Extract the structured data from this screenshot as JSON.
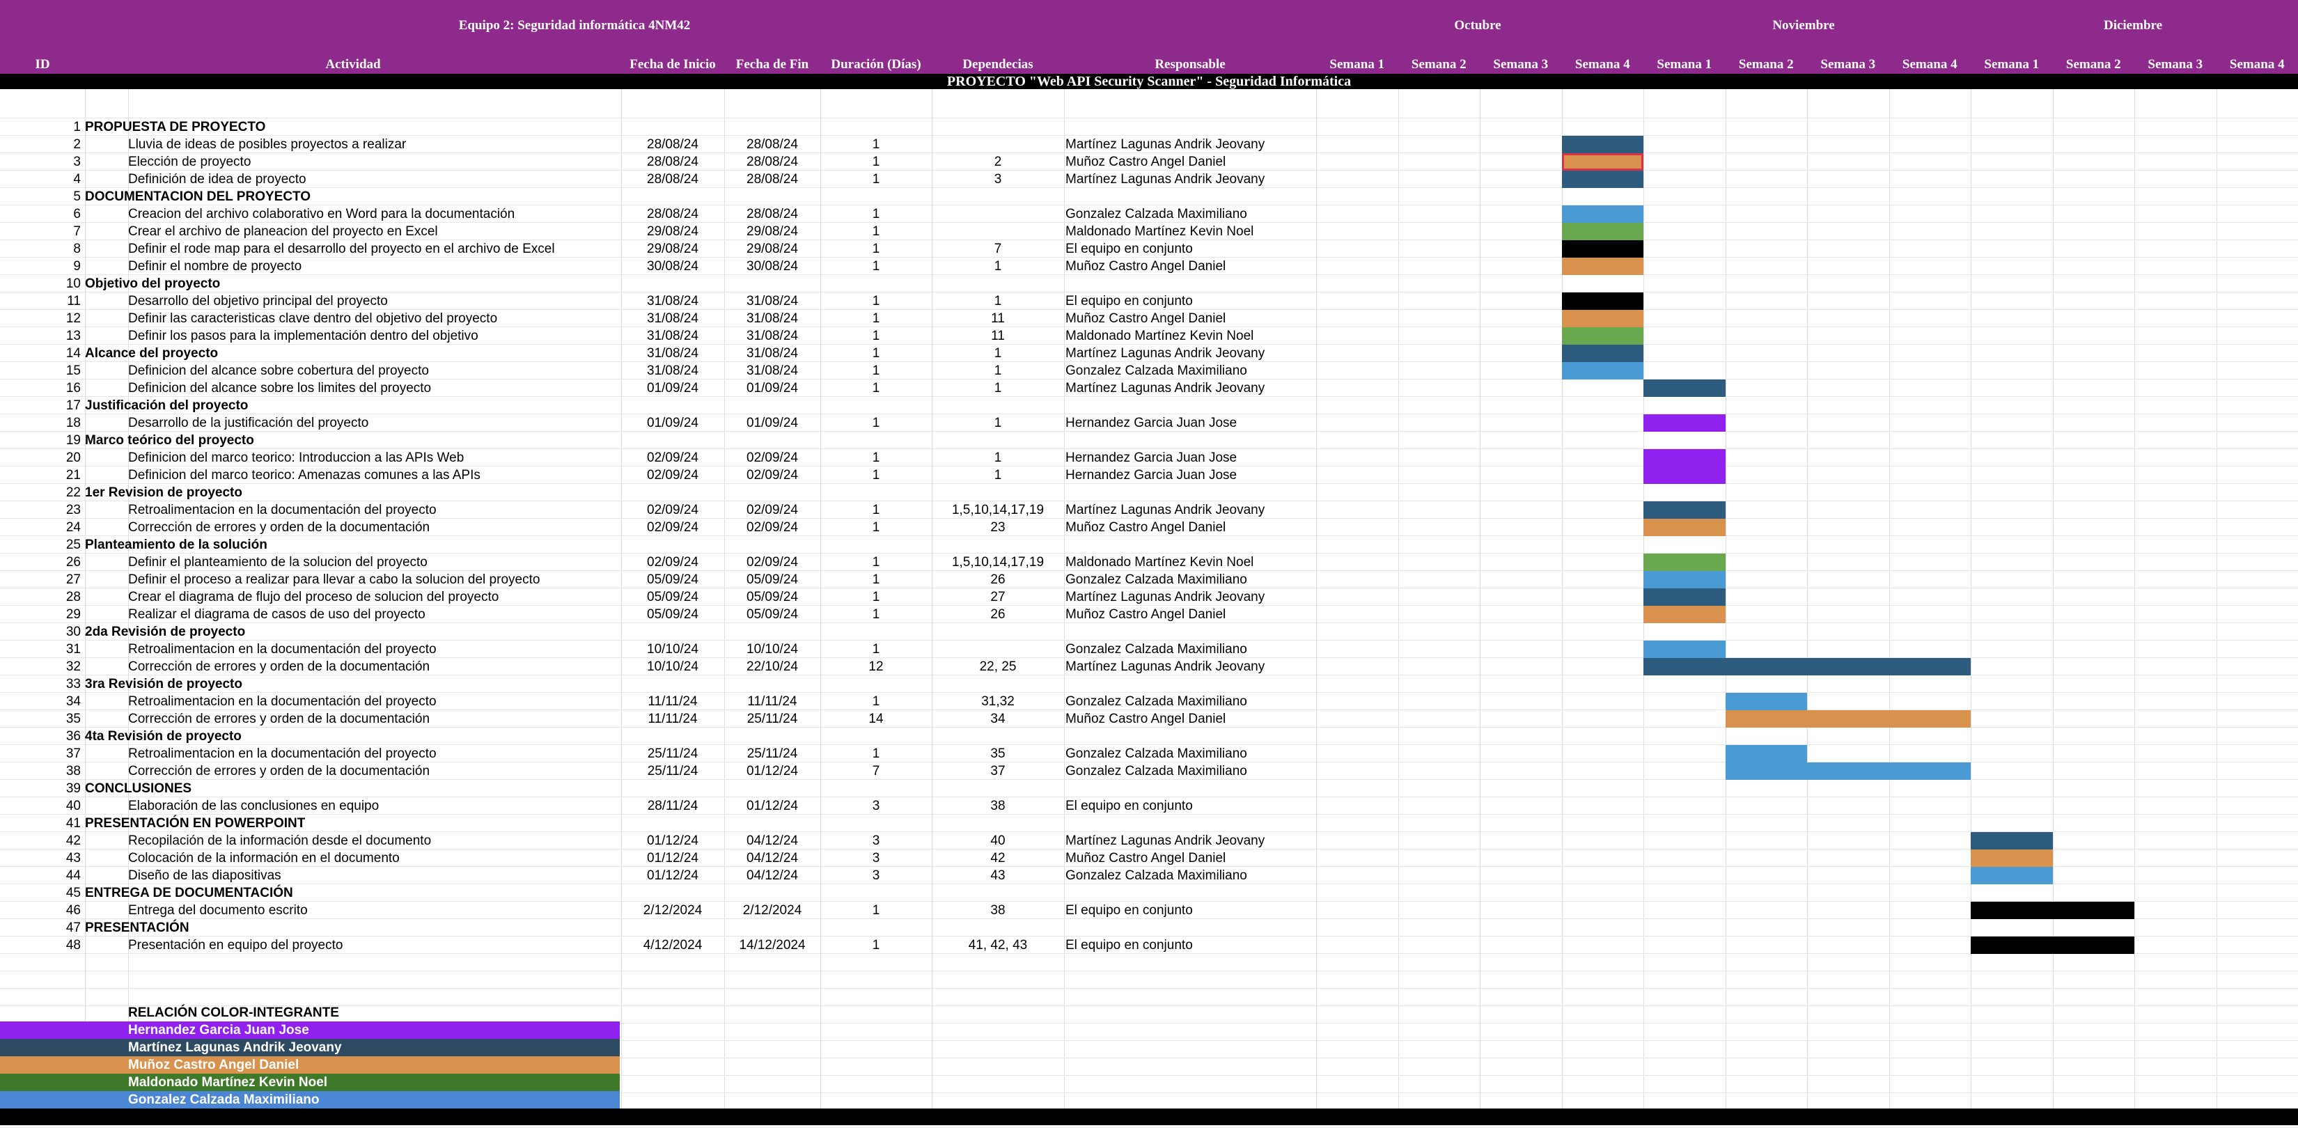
{
  "header": {
    "title": "Equipo 2: Seguridad informática 4NM42",
    "months": [
      "Octubre",
      "Noviembre",
      "Diciembre"
    ],
    "columns": {
      "id": "ID",
      "activity": "Actividad",
      "start": "Fecha de Inicio",
      "end": "Fecha de Fin",
      "duration": "Duración (Días)",
      "deps": "Dependecias",
      "responsible": "Responsable"
    },
    "weeks": [
      "Semana 1",
      "Semana 2",
      "Semana 3",
      "Semana 4",
      "Semana 1",
      "Semana 2",
      "Semana 3",
      "Semana 4",
      "Semana 1",
      "Semana 2",
      "Semana 3",
      "Semana 4"
    ]
  },
  "banner": "PROYECTO \"Web API Security Scanner\" - Seguridad Informática",
  "colors": {
    "header_bg": "#8e2a8c",
    "navy": "#2e5c7e",
    "orange": "#d9924d",
    "blue": "#4a9bd4",
    "green": "#6aa84f",
    "purple": "#9121ef",
    "black": "#000000",
    "selection_border": "#d6334a"
  },
  "rows": [
    {
      "id": "1",
      "activity": "PROPUESTA DE PROYECTO",
      "section": true
    },
    {
      "id": "2",
      "activity": "Lluvia de ideas de posibles proyectos a realizar",
      "start": "28/08/24",
      "end": "28/08/24",
      "duration": "1",
      "deps": "",
      "responsible": "Martínez Lagunas Andrik Jeovany",
      "bar": {
        "from": 3,
        "to": 3,
        "color": "navy"
      }
    },
    {
      "id": "3",
      "activity": "Elección de proyecto",
      "start": "28/08/24",
      "end": "28/08/24",
      "duration": "1",
      "deps": "2",
      "responsible": "Muñoz Castro Angel Daniel",
      "bar": {
        "from": 3,
        "to": 3,
        "color": "orange",
        "selected": true
      }
    },
    {
      "id": "4",
      "activity": "Definición de idea de proyecto",
      "start": "28/08/24",
      "end": "28/08/24",
      "duration": "1",
      "deps": "3",
      "responsible": "Martínez Lagunas Andrik Jeovany",
      "bar": {
        "from": 3,
        "to": 3,
        "color": "navy"
      }
    },
    {
      "id": "5",
      "activity": "DOCUMENTACION DEL PROYECTO",
      "section": true
    },
    {
      "id": "6",
      "activity": "Creacion del archivo colaborativo en Word para la documentación",
      "start": "28/08/24",
      "end": "28/08/24",
      "duration": "1",
      "deps": "",
      "responsible": "Gonzalez Calzada Maximiliano",
      "bar": {
        "from": 3,
        "to": 3,
        "color": "blue"
      }
    },
    {
      "id": "7",
      "activity": "Crear el archivo de planeacion del proyecto en Excel",
      "start": "29/08/24",
      "end": "29/08/24",
      "duration": "1",
      "deps": "",
      "responsible": "Maldonado Martínez Kevin Noel",
      "bar": {
        "from": 3,
        "to": 3,
        "color": "green"
      }
    },
    {
      "id": "8",
      "activity": "Definir el rode map para el desarrollo del proyecto en el archivo de Excel",
      "start": "29/08/24",
      "end": "29/08/24",
      "duration": "1",
      "deps": "7",
      "responsible": "El equipo en conjunto",
      "bar": {
        "from": 3,
        "to": 3,
        "color": "black"
      }
    },
    {
      "id": "9",
      "activity": "Definir el nombre de proyecto",
      "start": "30/08/24",
      "end": "30/08/24",
      "duration": "1",
      "deps": "1",
      "responsible": "Muñoz Castro Angel Daniel",
      "bar": {
        "from": 3,
        "to": 3,
        "color": "orange"
      }
    },
    {
      "id": "10",
      "activity": "Objetivo del proyecto",
      "section": true
    },
    {
      "id": "11",
      "activity": "Desarrollo del objetivo principal del proyecto",
      "start": "31/08/24",
      "end": "31/08/24",
      "duration": "1",
      "deps": "1",
      "responsible": "El equipo en conjunto",
      "bar": {
        "from": 3,
        "to": 3,
        "color": "black"
      }
    },
    {
      "id": "12",
      "activity": "Definir las caracteristicas clave dentro del objetivo del proyecto",
      "start": "31/08/24",
      "end": "31/08/24",
      "duration": "1",
      "deps": "11",
      "responsible": "Muñoz Castro Angel Daniel",
      "bar": {
        "from": 3,
        "to": 3,
        "color": "orange"
      }
    },
    {
      "id": "13",
      "activity": "Definir los pasos para la implementación dentro del objetivo",
      "start": "31/08/24",
      "end": "31/08/24",
      "duration": "1",
      "deps": "11",
      "responsible": "Maldonado Martínez Kevin Noel",
      "bar": {
        "from": 3,
        "to": 3,
        "color": "green"
      }
    },
    {
      "id": "14",
      "activity": "Alcance del proyecto",
      "section": true,
      "start": "31/08/24",
      "end": "31/08/24",
      "duration": "1",
      "deps": "1",
      "responsible": "Martínez Lagunas Andrik Jeovany",
      "bar": {
        "from": 3,
        "to": 3,
        "color": "navy"
      }
    },
    {
      "id": "15",
      "activity": "Definicion del alcance sobre cobertura del proyecto",
      "start": "31/08/24",
      "end": "31/08/24",
      "duration": "1",
      "deps": "1",
      "responsible": "Gonzalez Calzada Maximiliano",
      "bar": {
        "from": 3,
        "to": 3,
        "color": "blue"
      }
    },
    {
      "id": "16",
      "activity": "Definicion del alcance sobre los limites del proyecto",
      "start": "01/09/24",
      "end": "01/09/24",
      "duration": "1",
      "deps": "1",
      "responsible": "Martínez Lagunas Andrik Jeovany",
      "bar": {
        "from": 4,
        "to": 4,
        "color": "navy"
      }
    },
    {
      "id": "17",
      "activity": "Justificación del proyecto",
      "section": true
    },
    {
      "id": "18",
      "activity": "Desarrollo de la justificación del proyecto",
      "start": "01/09/24",
      "end": "01/09/24",
      "duration": "1",
      "deps": "1",
      "responsible": "Hernandez Garcia Juan Jose",
      "bar": {
        "from": 4,
        "to": 4,
        "color": "purple"
      }
    },
    {
      "id": "19",
      "activity": "Marco teórico del proyecto",
      "section": true
    },
    {
      "id": "20",
      "activity": "Definicion del marco teorico: Introduccion a las APIs Web",
      "start": "02/09/24",
      "end": "02/09/24",
      "duration": "1",
      "deps": "1",
      "responsible": "Hernandez Garcia Juan Jose",
      "bar": {
        "from": 4,
        "to": 4,
        "color": "purple"
      }
    },
    {
      "id": "21",
      "activity": "Definicion del marco teorico: Amenazas comunes a las APIs",
      "start": "02/09/24",
      "end": "02/09/24",
      "duration": "1",
      "deps": "1",
      "responsible": "Hernandez Garcia Juan Jose",
      "bar": {
        "from": 4,
        "to": 4,
        "color": "purple"
      }
    },
    {
      "id": "22",
      "activity": "1er Revision de proyecto",
      "section": true
    },
    {
      "id": "23",
      "activity": "Retroalimentacion en la documentación del proyecto",
      "start": "02/09/24",
      "end": "02/09/24",
      "duration": "1",
      "deps": "1,5,10,14,17,19",
      "responsible": "Martínez Lagunas Andrik Jeovany",
      "bar": {
        "from": 4,
        "to": 4,
        "color": "navy"
      }
    },
    {
      "id": "24",
      "activity": "Corrección de errores y orden de la documentación",
      "start": "02/09/24",
      "end": "02/09/24",
      "duration": "1",
      "deps": "23",
      "responsible": "Muñoz Castro Angel Daniel",
      "bar": {
        "from": 4,
        "to": 4,
        "color": "orange"
      }
    },
    {
      "id": "25",
      "activity": "Planteamiento de la solución",
      "section": true
    },
    {
      "id": "26",
      "activity": "Definir el planteamiento de la solucion del proyecto",
      "start": "02/09/24",
      "end": "02/09/24",
      "duration": "1",
      "deps": "1,5,10,14,17,19",
      "responsible": "Maldonado Martínez Kevin Noel",
      "bar": {
        "from": 4,
        "to": 4,
        "color": "green"
      }
    },
    {
      "id": "27",
      "activity": "Definir el proceso a realizar para llevar a cabo la solucion del proyecto",
      "start": "05/09/24",
      "end": "05/09/24",
      "duration": "1",
      "deps": "26",
      "responsible": "Gonzalez Calzada Maximiliano",
      "bar": {
        "from": 4,
        "to": 4,
        "color": "blue"
      }
    },
    {
      "id": "28",
      "activity": "Crear el diagrama de flujo del proceso de solucion del proyecto",
      "start": "05/09/24",
      "end": "05/09/24",
      "duration": "1",
      "deps": "27",
      "responsible": "Martínez Lagunas Andrik Jeovany",
      "bar": {
        "from": 4,
        "to": 4,
        "color": "navy"
      }
    },
    {
      "id": "29",
      "activity": "Realizar el diagrama de casos de uso del proyecto",
      "start": "05/09/24",
      "end": "05/09/24",
      "duration": "1",
      "deps": "26",
      "responsible": "Muñoz Castro Angel Daniel",
      "bar": {
        "from": 4,
        "to": 4,
        "color": "orange"
      }
    },
    {
      "id": "30",
      "activity": "2da Revisión de proyecto",
      "section": true
    },
    {
      "id": "31",
      "activity": "Retroalimentacion en la documentación del proyecto",
      "start": "10/10/24",
      "end": "10/10/24",
      "duration": "1",
      "deps": "",
      "responsible": "Gonzalez Calzada Maximiliano",
      "bar": {
        "from": 4,
        "to": 4,
        "color": "blue"
      }
    },
    {
      "id": "32",
      "activity": "Corrección de errores y orden de la documentación",
      "start": "10/10/24",
      "end": "22/10/24",
      "duration": "12",
      "deps": "22, 25",
      "responsible": "Martínez Lagunas Andrik Jeovany",
      "bar": {
        "from": 4,
        "to": 7,
        "color": "navy"
      }
    },
    {
      "id": "33",
      "activity": "3ra Revisión de proyecto",
      "section": true
    },
    {
      "id": "34",
      "activity": "Retroalimentacion en la documentación del proyecto",
      "start": "11/11/24",
      "end": "11/11/24",
      "duration": "1",
      "deps": "31,32",
      "responsible": "Gonzalez Calzada Maximiliano",
      "bar": {
        "from": 5,
        "to": 5,
        "color": "blue"
      }
    },
    {
      "id": "35",
      "activity": "Corrección de errores y orden de la documentación",
      "start": "11/11/24",
      "end": "25/11/24",
      "duration": "14",
      "deps": "34",
      "responsible": "Muñoz Castro Angel Daniel",
      "bar": {
        "from": 5,
        "to": 7,
        "color": "orange"
      }
    },
    {
      "id": "36",
      "activity": "4ta Revisión de proyecto",
      "section": true
    },
    {
      "id": "37",
      "activity": "Retroalimentacion en la documentación del proyecto",
      "start": "25/11/24",
      "end": "25/11/24",
      "duration": "1",
      "deps": "35",
      "responsible": "Gonzalez Calzada Maximiliano",
      "bar": {
        "from": 5,
        "to": 5,
        "color": "blue"
      }
    },
    {
      "id": "38",
      "activity": "Corrección de errores y orden de la documentación",
      "start": "25/11/24",
      "end": "01/12/24",
      "duration": "7",
      "deps": "37",
      "responsible": "Gonzalez Calzada Maximiliano",
      "bar": {
        "from": 5,
        "to": 7,
        "color": "blue"
      }
    },
    {
      "id": "39",
      "activity": "CONCLUSIONES",
      "section": true
    },
    {
      "id": "40",
      "activity": "Elaboración de las conclusiones en equipo",
      "start": "28/11/24",
      "end": "01/12/24",
      "duration": "3",
      "deps": "38",
      "responsible": "El equipo en conjunto"
    },
    {
      "id": "41",
      "activity": "PRESENTACIÓN EN POWERPOINT",
      "section": true
    },
    {
      "id": "42",
      "activity": "Recopilación de la información desde el documento",
      "start": "01/12/24",
      "end": "04/12/24",
      "duration": "3",
      "deps": "40",
      "responsible": "Martínez Lagunas Andrik Jeovany",
      "bar": {
        "from": 8,
        "to": 8,
        "color": "navy"
      }
    },
    {
      "id": "43",
      "activity": "Colocación de la información en el documento",
      "start": "01/12/24",
      "end": "04/12/24",
      "duration": "3",
      "deps": "42",
      "responsible": "Muñoz Castro Angel Daniel",
      "bar": {
        "from": 8,
        "to": 8,
        "color": "orange"
      }
    },
    {
      "id": "44",
      "activity": "Diseño de las diapositivas",
      "start": "01/12/24",
      "end": "04/12/24",
      "duration": "3",
      "deps": "43",
      "responsible": "Gonzalez Calzada Maximiliano",
      "bar": {
        "from": 8,
        "to": 8,
        "color": "blue"
      }
    },
    {
      "id": "45",
      "activity": "ENTREGA DE DOCUMENTACIÓN",
      "section": true
    },
    {
      "id": "46",
      "activity": "Entrega del documento escrito",
      "start": "2/12/2024",
      "end": "2/12/2024",
      "duration": "1",
      "deps": "38",
      "responsible": "El equipo en conjunto",
      "bar": {
        "from": 8,
        "to": 9,
        "color": "black"
      }
    },
    {
      "id": "47",
      "activity": "PRESENTACIÓN",
      "section": true
    },
    {
      "id": "48",
      "activity": "Presentación en equipo del proyecto",
      "start": "4/12/2024",
      "end": "14/12/2024",
      "duration": "1",
      "deps": "41, 42, 43",
      "responsible": "El equipo en conjunto",
      "bar": {
        "from": 8,
        "to": 9,
        "color": "black"
      }
    }
  ],
  "legend": {
    "title": "RELACIÓN COLOR-INTEGRANTE",
    "items": [
      {
        "name": "Hernandez Garcia Juan Jose",
        "color": "#9121ef"
      },
      {
        "name": "Martínez Lagunas Andrik Jeovany",
        "color": "#2e4a63"
      },
      {
        "name": "Muñoz Castro Angel Daniel",
        "color": "#d9924d"
      },
      {
        "name": "Maldonado Martínez Kevin Noel",
        "color": "#3f7a2a"
      },
      {
        "name": "Gonzalez Calzada Maximiliano",
        "color": "#4a86d4"
      }
    ]
  }
}
